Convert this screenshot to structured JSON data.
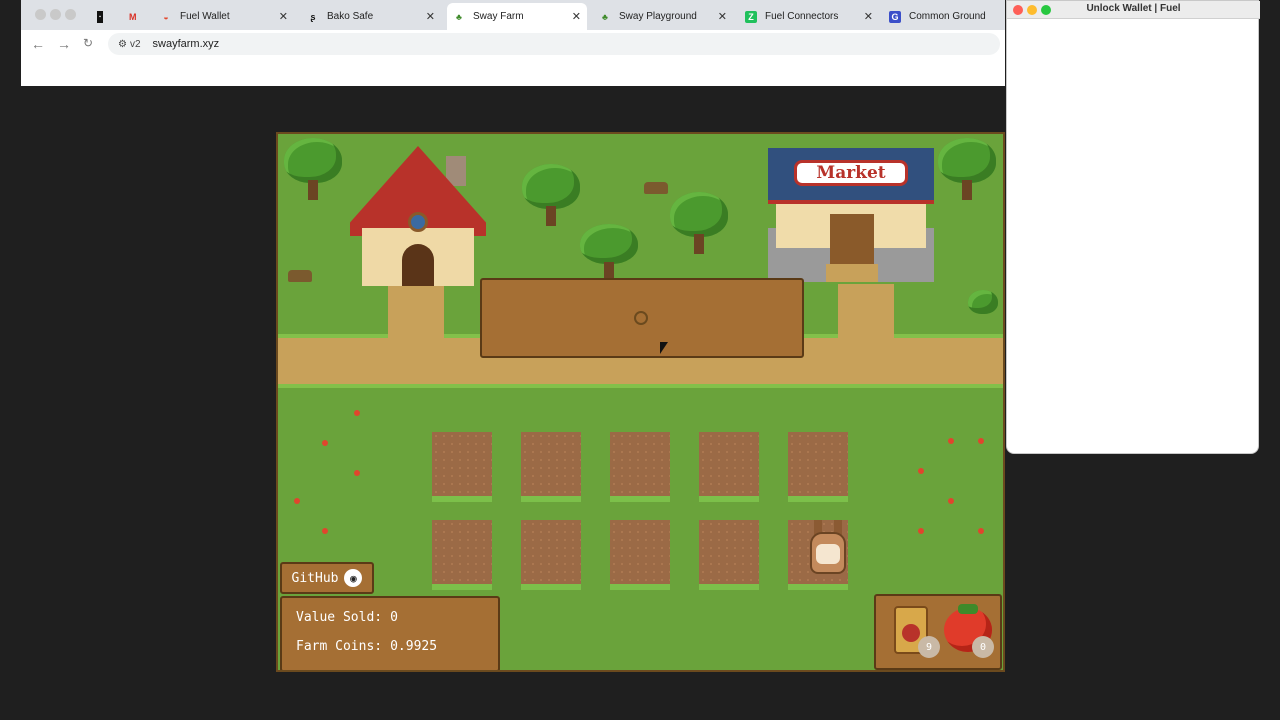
{
  "browser": {
    "tabs": [
      {
        "label": "",
        "icon": "app-icon"
      },
      {
        "label": "",
        "icon": "gmail-icon"
      },
      {
        "label": "Fuel Wallet",
        "icon": "fuel-wallet-icon"
      },
      {
        "label": "Bako Safe",
        "icon": "bako-icon"
      },
      {
        "label": "Sway Farm",
        "icon": "palm-icon",
        "active": true
      },
      {
        "label": "Sway Playground",
        "icon": "palm-icon"
      },
      {
        "label": "Fuel Connectors",
        "icon": "fuel-connectors-icon"
      },
      {
        "label": "Common Ground",
        "icon": "common-ground-icon"
      }
    ],
    "site_chip": "v2",
    "url": "swayfarm.xyz"
  },
  "game": {
    "market_sign": "Market",
    "github_label": "GitHub",
    "stats": {
      "value_sold_label": "Value Sold:",
      "value_sold": "0",
      "farm_coins_label": "Farm Coins:",
      "farm_coins": "0.9925"
    },
    "inventory": {
      "seeds_count": "9",
      "tomato_count": "0"
    }
  },
  "wallet_popup": {
    "title": "Unlock Wallet | Fuel"
  },
  "colors": {
    "grass": "#6aa33b",
    "panel": "#a56f34",
    "panel_border": "#5a3a16",
    "dirt": "#9b6a46"
  }
}
